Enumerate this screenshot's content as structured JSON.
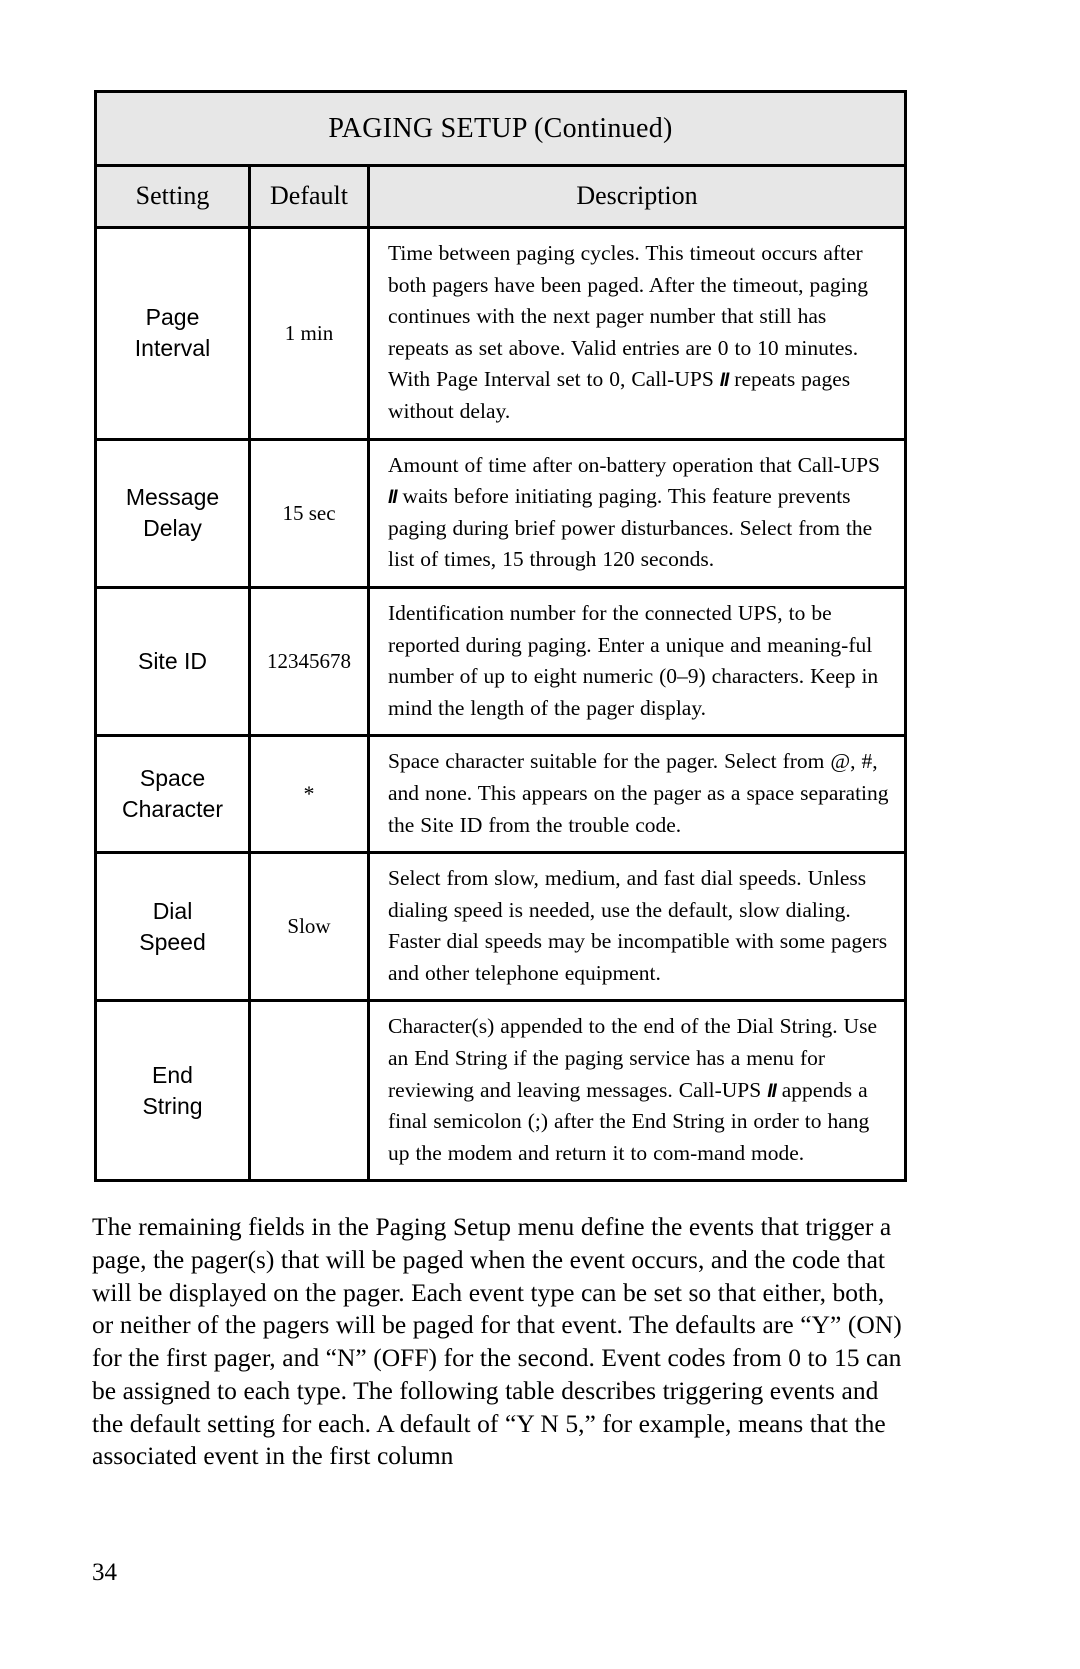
{
  "document": {
    "page_number": "34"
  },
  "table": {
    "title": "PAGING SETUP (Continued)",
    "columns": {
      "setting": "Setting",
      "default": "Default",
      "description": "Description"
    },
    "rows": [
      {
        "setting": "Page\nInterval",
        "default": "1 min",
        "description_pre": "Time between paging cycles. This timeout occurs after both pagers have been paged. After the timeout, paging continues with the next pager number that still has repeats as set above. Valid entries are 0 to 10 minutes. With Page Interval set to 0, Call-UPS ",
        "description_mark": "II",
        "description_post": " repeats pages without delay."
      },
      {
        "setting": "Message\nDelay",
        "default": "15 sec",
        "description_pre": "Amount of time after on-battery operation that Call-UPS ",
        "description_mark": "II",
        "description_post": " waits before initiating paging. This feature prevents paging during brief power disturbances. Select from the list of times, 15 through 120 seconds."
      },
      {
        "setting": "Site   ID",
        "default": "12345678",
        "description_pre": "Identification number for the connected UPS, to be reported during paging. Enter a unique and meaning-ful number of up to eight numeric (0–9) characters. Keep in mind the length of the pager display.",
        "description_mark": "",
        "description_post": ""
      },
      {
        "setting": "Space\nCharacter",
        "default": "*",
        "description_pre": "Space character suitable for the pager. Select from @, #, and none. This appears on the pager as a space separating the Site ID from the trouble code.",
        "description_mark": "",
        "description_post": ""
      },
      {
        "setting": "Dial\nSpeed",
        "default": "Slow",
        "description_pre": "Select from slow, medium, and fast dial speeds. Unless dialing speed is needed, use the default, slow dialing. Faster dial speeds may be incompatible with some pagers and other telephone equipment.",
        "description_mark": "",
        "description_post": ""
      },
      {
        "setting": "End\nString",
        "default": "",
        "description_pre": "Character(s) appended to the end of the Dial String. Use an End String if the paging service has a menu for reviewing and leaving messages. Call-UPS ",
        "description_mark": "II",
        "description_post": " appends a final semicolon (;) after the End String in order to hang up the modem and return it to com-mand mode."
      }
    ]
  },
  "body": {
    "paragraph": "The remaining fields in the Paging Setup menu define the events that trigger a page, the pager(s) that will be paged when the event occurs, and the code that will be displayed on the pager. Each event type can be set so that either, both, or neither of the pagers will be paged for that event. The defaults are “Y” (ON) for the first pager, and “N” (OFF) for the second. Event codes from 0 to 15 can be assigned to each type. The following table describes triggering events and the default setting for each. A default of “Y N 5,” for example, means that the associated event in the first column"
  }
}
